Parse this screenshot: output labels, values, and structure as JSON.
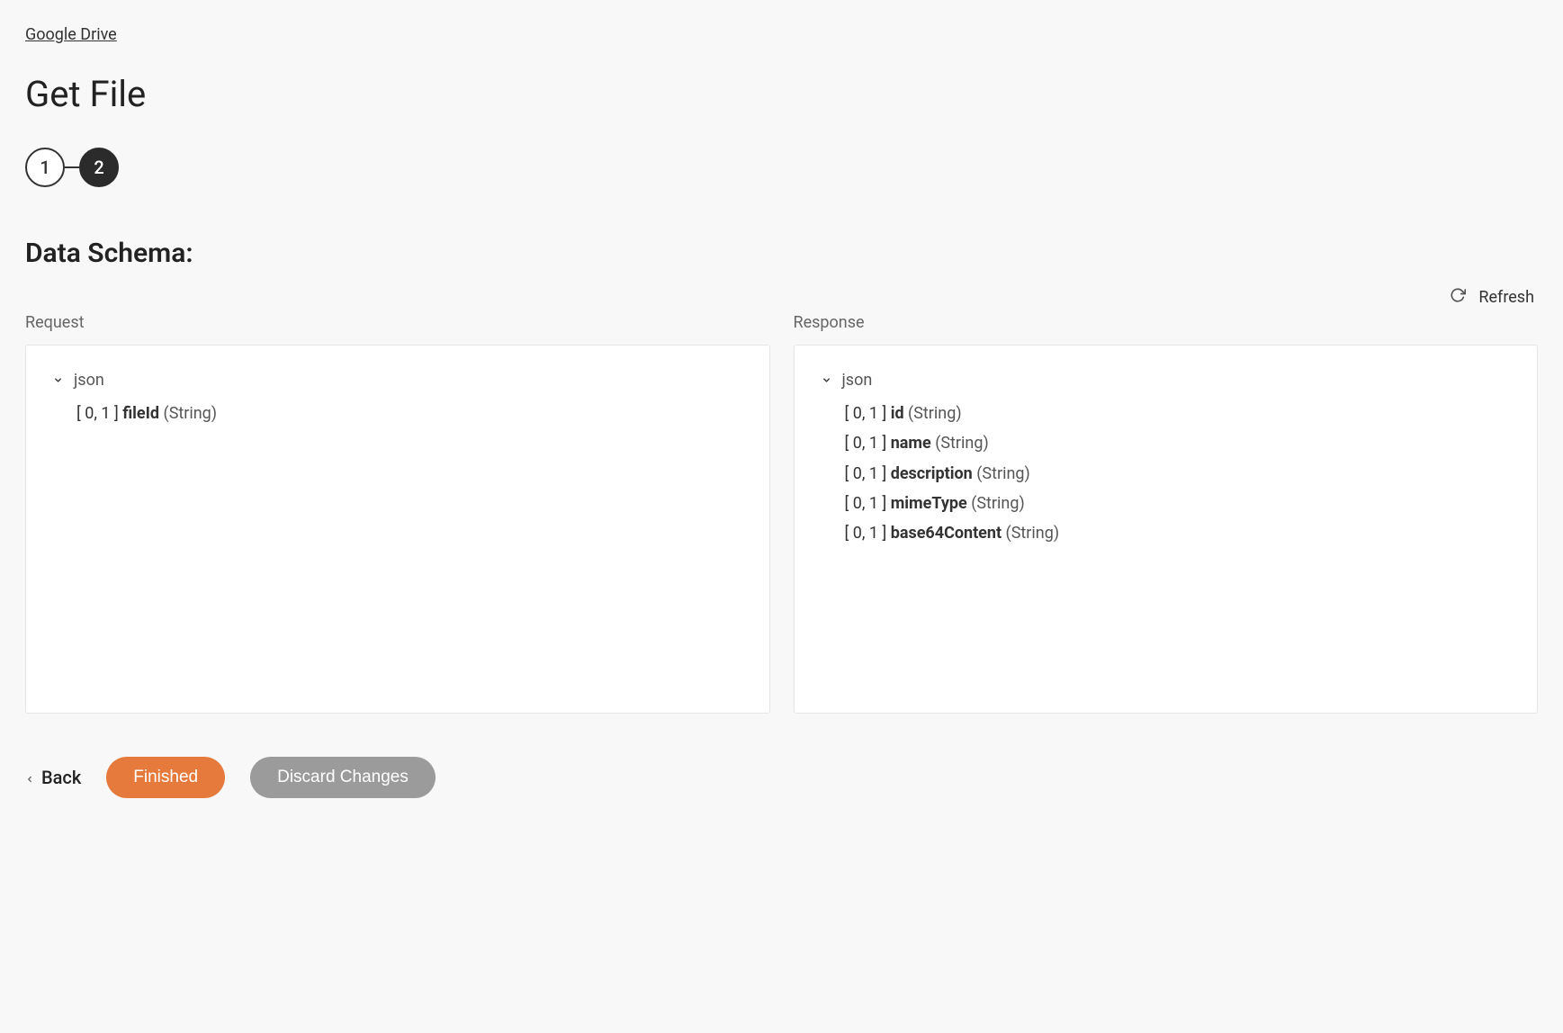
{
  "breadcrumb": {
    "parent": "Google Drive"
  },
  "title": "Get File",
  "stepper": {
    "steps": [
      "1",
      "2"
    ],
    "active_index": 1
  },
  "section": {
    "heading": "Data Schema:"
  },
  "refresh": {
    "label": "Refresh"
  },
  "columns": {
    "request": {
      "label": "Request",
      "root": "json",
      "fields": [
        {
          "cardinality": "[ 0, 1 ]",
          "name": "fileId",
          "type": "(String)"
        }
      ]
    },
    "response": {
      "label": "Response",
      "root": "json",
      "fields": [
        {
          "cardinality": "[ 0, 1 ]",
          "name": "id",
          "type": "(String)"
        },
        {
          "cardinality": "[ 0, 1 ]",
          "name": "name",
          "type": "(String)"
        },
        {
          "cardinality": "[ 0, 1 ]",
          "name": "description",
          "type": "(String)"
        },
        {
          "cardinality": "[ 0, 1 ]",
          "name": "mimeType",
          "type": "(String)"
        },
        {
          "cardinality": "[ 0, 1 ]",
          "name": "base64Content",
          "type": "(String)"
        }
      ]
    }
  },
  "footer": {
    "back": "Back",
    "primary": "Finished",
    "secondary": "Discard Changes"
  }
}
